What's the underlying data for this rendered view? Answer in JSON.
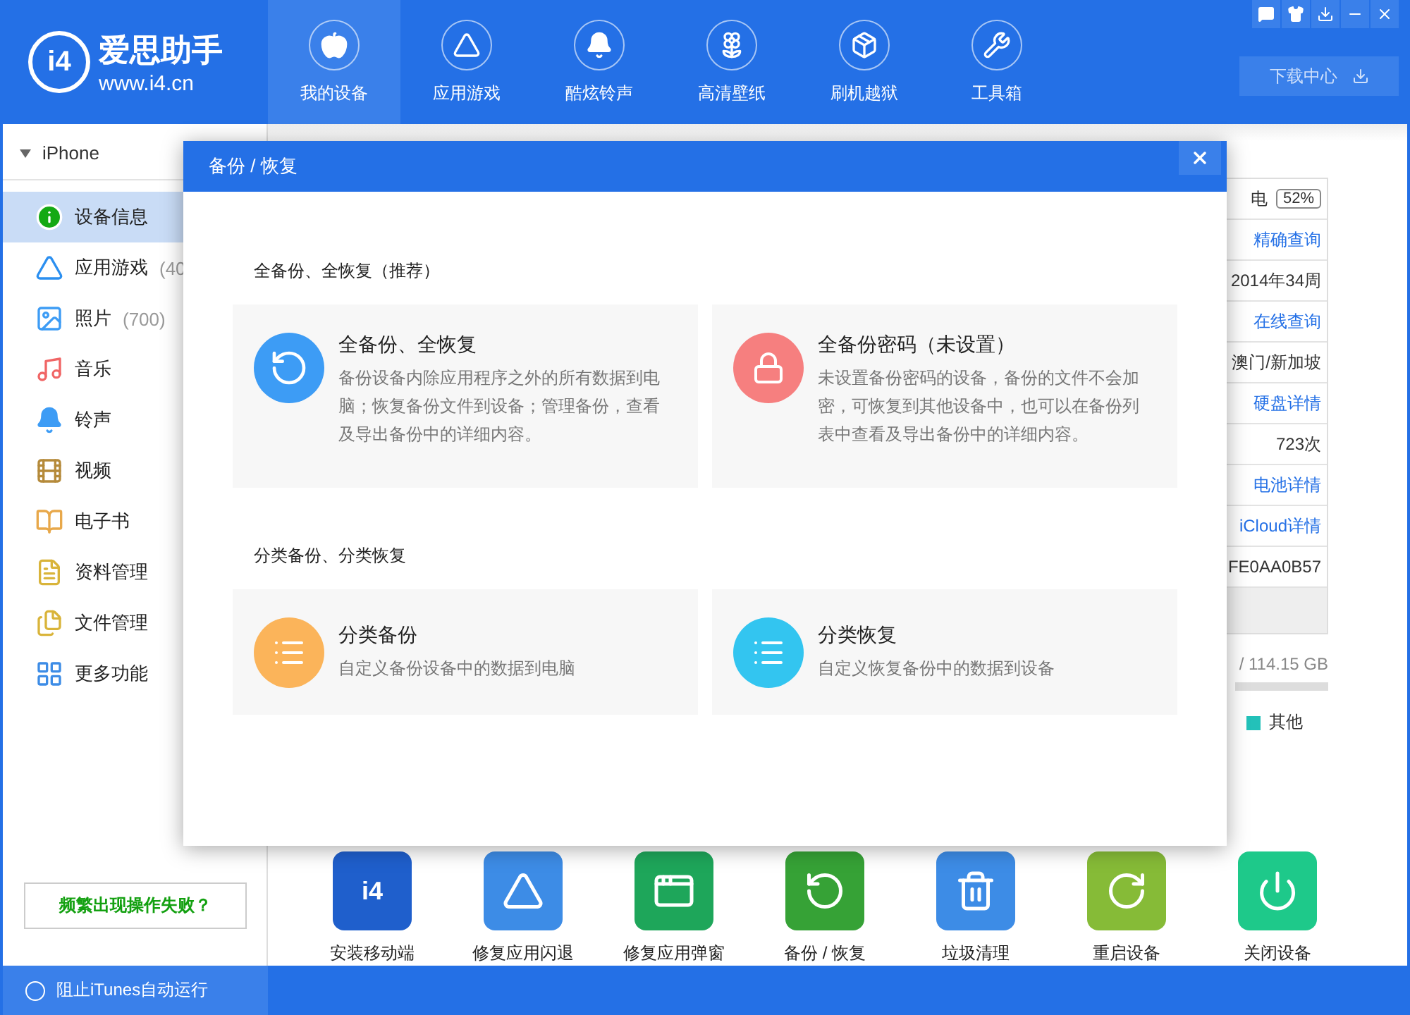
{
  "app": {
    "mark": "i4",
    "name": "爱思助手",
    "url": "www.i4.cn"
  },
  "nav": [
    {
      "kind": "apple",
      "label": "我的设备",
      "selected": true
    },
    {
      "kind": "appstore",
      "label": "应用游戏",
      "selected": false
    },
    {
      "kind": "bell",
      "label": "酷炫铃声",
      "selected": false
    },
    {
      "kind": "flower",
      "label": "高清壁纸",
      "selected": false
    },
    {
      "kind": "box",
      "label": "刷机越狱",
      "selected": false
    },
    {
      "kind": "tools",
      "label": "工具箱",
      "selected": false
    }
  ],
  "download_button": "下载中心",
  "sidebar": {
    "device": "iPhone",
    "expanded": true,
    "items": [
      {
        "kind": "info",
        "label": "设备信息",
        "selected": true
      },
      {
        "kind": "apps",
        "label": "应用游戏",
        "count": "(40",
        "selected": false
      },
      {
        "kind": "photos",
        "label": "照片",
        "count": "(700)",
        "selected": false
      },
      {
        "kind": "music",
        "label": "音乐",
        "selected": false
      },
      {
        "kind": "ringtone",
        "label": "铃声",
        "selected": false
      },
      {
        "kind": "video",
        "label": "视频",
        "selected": false
      },
      {
        "kind": "book",
        "label": "电子书",
        "selected": false
      },
      {
        "kind": "data",
        "label": "资料管理",
        "selected": false
      },
      {
        "kind": "files",
        "label": "文件管理",
        "selected": false
      },
      {
        "kind": "more",
        "label": "更多功能",
        "selected": false
      }
    ],
    "help_button": "频繁出现操作失败？"
  },
  "device_info": [
    {
      "kind": "battery",
      "label": "电",
      "value": "52%"
    },
    {
      "kind": "link",
      "value": "精确查询"
    },
    {
      "kind": "text",
      "value": "2014年34周"
    },
    {
      "kind": "link",
      "value": "在线查询"
    },
    {
      "kind": "text",
      "value": "澳门/新加坡"
    },
    {
      "kind": "link",
      "value": "硬盘详情"
    },
    {
      "kind": "text",
      "value": "723次"
    },
    {
      "kind": "link",
      "value": "电池详情"
    },
    {
      "kind": "link",
      "value": "iCloud详情"
    },
    {
      "kind": "text",
      "value": "FE0AA0B57"
    }
  ],
  "storage": {
    "total": "/ 114.15 GB",
    "legend": [
      {
        "label": "其他",
        "color": "#23c1b9"
      }
    ]
  },
  "tools": [
    {
      "kind": "i4",
      "icon_text": "i4",
      "label": "安装移动端",
      "color": "#1f5fcc"
    },
    {
      "kind": "appstore",
      "label": "修复应用闪退",
      "color": "#3d8ce6"
    },
    {
      "kind": "window",
      "label": "修复应用弹窗",
      "color": "#1ea65a"
    },
    {
      "kind": "backup",
      "label": "备份 / 恢复",
      "color": "#36a236"
    },
    {
      "kind": "broom",
      "label": "垃圾清理",
      "color": "#3d8ce6"
    },
    {
      "kind": "restart",
      "label": "重启设备",
      "color": "#86bb37"
    },
    {
      "kind": "power",
      "label": "关闭设备",
      "color": "#1ec98a"
    }
  ],
  "footer": {
    "itunes_block": {
      "label": "阻止iTunes自动运行",
      "checked": false
    }
  },
  "modal": {
    "title": "备份 / 恢复",
    "sections": [
      {
        "title": "全备份、全恢复（推荐）",
        "cards": [
          {
            "kind": "restore",
            "title": "全备份、全恢复",
            "color": "#3d9cf5",
            "description": "备份设备内除应用程序之外的所有数据到电脑；恢复备份文件到设备；管理备份，查看及导出备份中的详细内容。"
          },
          {
            "kind": "lock",
            "title": "全备份密码（未设置）",
            "color": "#f67f7f",
            "description": "未设置备份密码的设备，备份的文件不会加密，可恢复到其他设备中，也可以在备份列表中查看及导出备份中的详细内容。"
          }
        ]
      },
      {
        "title": "分类备份、分类恢复",
        "cards": [
          {
            "kind": "list-backup",
            "title": "分类备份",
            "color": "#fbb45a",
            "description": "自定义备份设备中的数据到电脑"
          },
          {
            "kind": "list-restore",
            "title": "分类恢复",
            "color": "#33c5f0",
            "description": "自定义恢复备份中的数据到设备"
          }
        ]
      }
    ]
  }
}
